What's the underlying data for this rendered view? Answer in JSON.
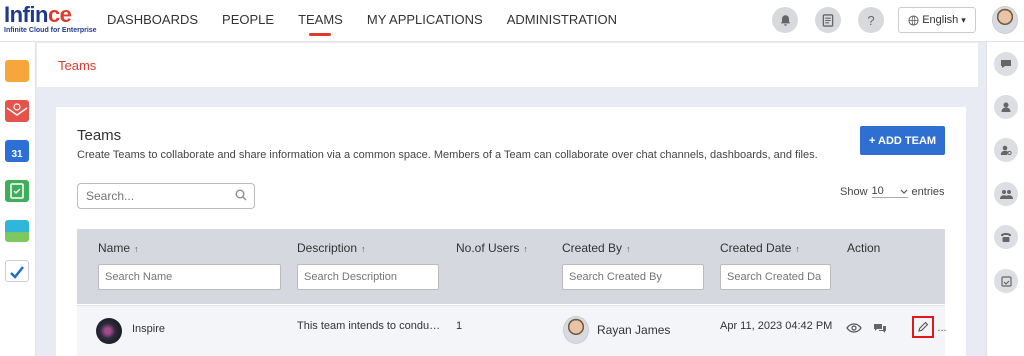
{
  "logo": {
    "main": "Infin",
    "accent": "ce",
    "tagline": "Infinite Cloud for Enterprise"
  },
  "nav": {
    "items": [
      {
        "label": "DASHBOARDS"
      },
      {
        "label": "PEOPLE"
      },
      {
        "label": "TEAMS",
        "active": true
      },
      {
        "label": "MY APPLICATIONS"
      },
      {
        "label": "ADMINISTRATION"
      }
    ]
  },
  "header": {
    "icons": [
      "bell-icon",
      "notes-icon",
      "help-icon"
    ],
    "help_glyph": "?",
    "language": "English",
    "language_caret": "▾"
  },
  "leftbar": {
    "apps": [
      "folder-app-icon",
      "mail-app-icon",
      "calendar-app-icon",
      "tasks-app-icon",
      "gallery-app-icon",
      "cloud-app-icon"
    ],
    "calendar_day": "31"
  },
  "rightbar": {
    "icons": [
      "chat-icon",
      "user-icon",
      "user-settings-icon",
      "users-icon",
      "phone-icon",
      "calendar-check-icon"
    ]
  },
  "breadcrumb": {
    "label": "Teams"
  },
  "page": {
    "title": "Teams",
    "subtitle": "Create Teams to collaborate and share information via a common space. Members of a Team can collaborate over chat channels, dashboards, and files.",
    "add_button": "+ ADD TEAM",
    "search_placeholder": "Search...",
    "show_label": "Show",
    "page_size": "10",
    "entries_label": "entries"
  },
  "table": {
    "sort_glyph": "↑",
    "columns": [
      {
        "label": "Name",
        "filter_placeholder": "Search Name"
      },
      {
        "label": "Description",
        "filter_placeholder": "Search Description"
      },
      {
        "label": "No.of Users",
        "filter_placeholder": ""
      },
      {
        "label": "Created By",
        "filter_placeholder": "Search Created By"
      },
      {
        "label": "Created Date",
        "filter_placeholder": "Search Created Da"
      },
      {
        "label": "Action",
        "filter_placeholder": ""
      }
    ],
    "rows": [
      {
        "name": "Inspire",
        "description": "This team intends to condu…",
        "users": "1",
        "created_by": "Rayan James",
        "created_date": "Apr 11, 2023 04:42 PM",
        "actions": [
          "view-icon",
          "chat-icon",
          "edit-icon",
          "more-icon"
        ],
        "more_glyph": "..."
      }
    ]
  },
  "colors": {
    "accent": "#e0392b",
    "primary_button": "#2f6fd1",
    "highlight": "#e01a1a"
  }
}
